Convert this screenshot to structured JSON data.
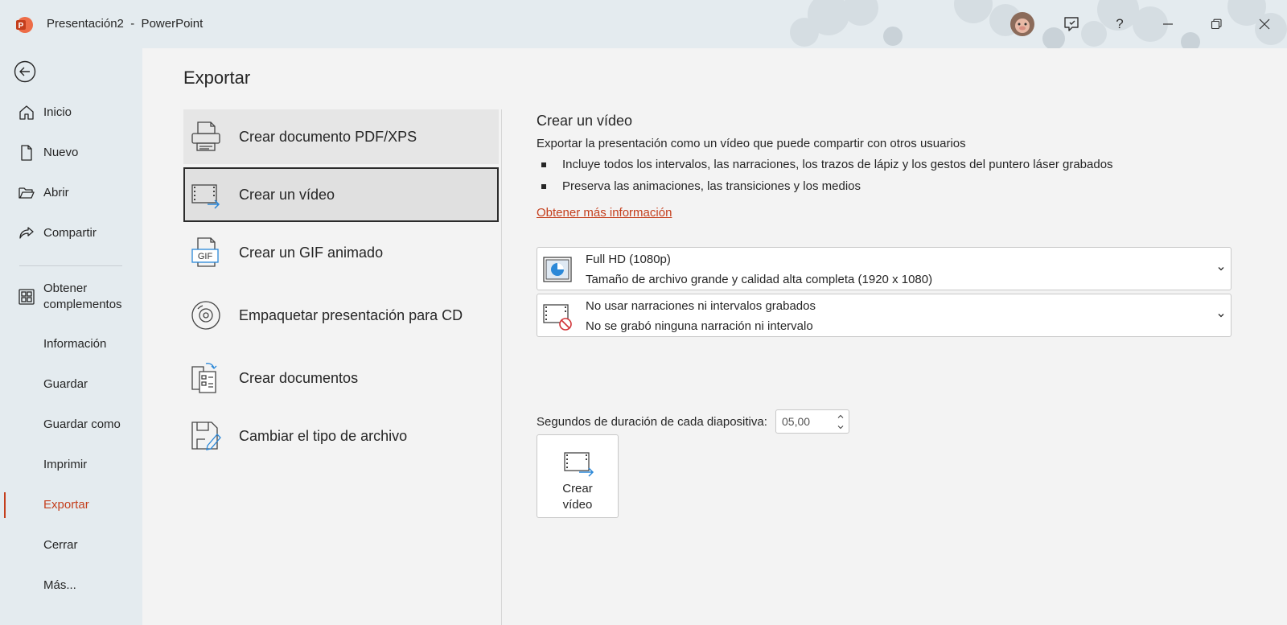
{
  "titlebar": {
    "title": "Presentación2  -  PowerPoint",
    "help": "?"
  },
  "sidebar": {
    "items": [
      {
        "label": "Inicio",
        "icon": "home-icon"
      },
      {
        "label": "Nuevo",
        "icon": "new-document-icon"
      },
      {
        "label": "Abrir",
        "icon": "folder-open-icon"
      },
      {
        "label": "Compartir",
        "icon": "share-icon"
      },
      {
        "label": "Obtener\ncomplementos",
        "icon": "add-ins-icon"
      },
      {
        "label": "Información"
      },
      {
        "label": "Guardar"
      },
      {
        "label": "Guardar como"
      },
      {
        "label": "Imprimir"
      },
      {
        "label": "Exportar",
        "active": true
      },
      {
        "label": "Cerrar"
      },
      {
        "label": "Más..."
      }
    ]
  },
  "page": {
    "title": "Exportar"
  },
  "options": [
    {
      "label": "Crear documento PDF/XPS",
      "icon": "pdf-xps-icon"
    },
    {
      "label": "Crear un vídeo",
      "icon": "video-icon",
      "selected": true
    },
    {
      "label": "Crear un GIF animado",
      "icon": "gif-icon"
    },
    {
      "label": "Empaquetar presentación para CD",
      "icon": "cd-icon"
    },
    {
      "label": "Crear documentos",
      "icon": "handouts-icon"
    },
    {
      "label": "Cambiar el tipo de archivo",
      "icon": "change-file-type-icon"
    }
  ],
  "details": {
    "title": "Crear un vídeo",
    "description": "Exportar la presentación como un vídeo que puede compartir con otros usuarios",
    "bullets": [
      "Incluye todos los intervalos, las narraciones, los trazos de lápiz y los gestos del puntero láser grabados",
      "Preserva las animaciones, las transiciones y los medios"
    ],
    "link": "Obtener más información",
    "quality": {
      "title": "Full HD (1080p)",
      "subtitle": "Tamaño de archivo grande y calidad alta completa (1920 x 1080)"
    },
    "narration": {
      "title": "No usar narraciones ni intervalos grabados",
      "subtitle": "No se grabó ninguna narración ni intervalo"
    },
    "duration_label": "Segundos de duración de cada diapositiva:",
    "duration_value": "05,00",
    "create_button": "Crear\nvídeo"
  },
  "colors": {
    "accent": "#c43e1c",
    "sidebar_bg": "#e4ebef",
    "main_bg": "#f3f3f3"
  }
}
